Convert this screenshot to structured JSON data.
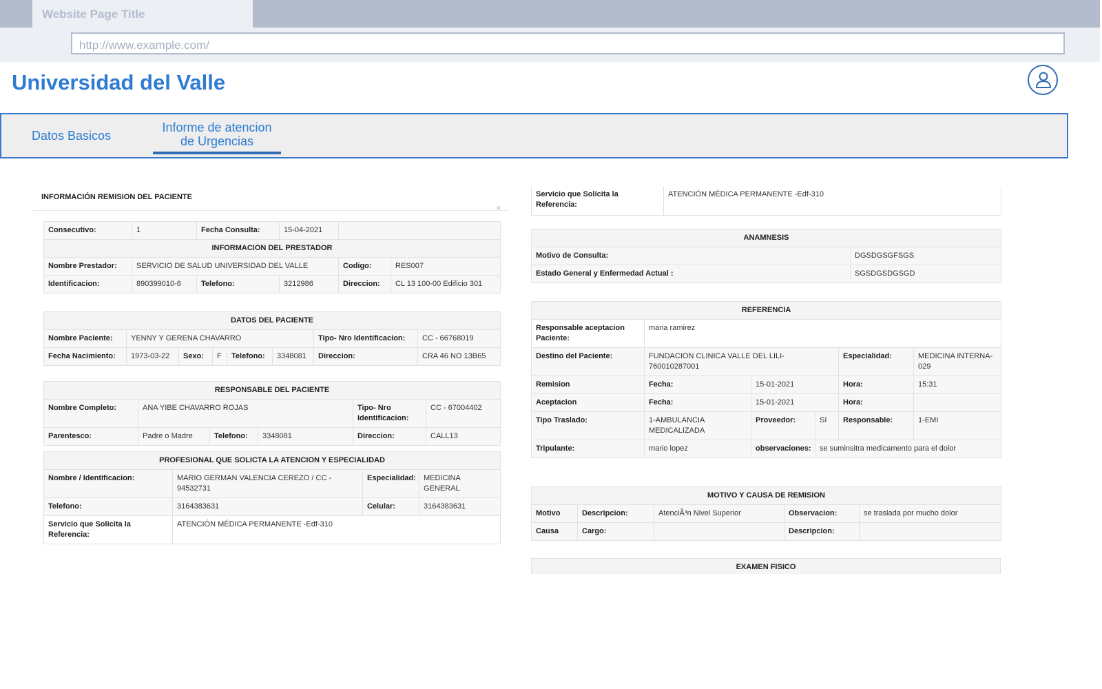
{
  "browser": {
    "tab_title": "Website Page Title",
    "url": "http://www.example.com/"
  },
  "app": {
    "title": "Universidad del Valle",
    "user_icon": "user-icon"
  },
  "tabs": [
    {
      "label": "Datos Basicos"
    },
    {
      "label_line1": "Informe de atencion",
      "label_line2": "de Urgencias"
    }
  ],
  "report": {
    "section_title": "INFORMACIÓN REMISION DEL PACIENTE",
    "close_symbol": "×",
    "consulta": {
      "consecutivo_label": "Consecutivo:",
      "consecutivo": "1",
      "fecha_label": "Fecha Consulta:",
      "fecha": "15-04-2021"
    },
    "prestador": {
      "title": "INFORMACION DEL PRESTADOR",
      "nombre_label": "Nombre Prestador:",
      "nombre": "SERVICIO DE SALUD UNIVERSIDAD DEL VALLE",
      "codigo_label": "Codigo:",
      "codigo": "RES007",
      "id_label": "Identificacion:",
      "id": "890399010-6",
      "tel_label": "Telefono:",
      "tel": "3212986",
      "dir_label": "Direccion:",
      "dir": "CL 13 100-00 Edificio 301"
    },
    "paciente": {
      "title": "DATOS DEL PACIENTE",
      "nombre_label": "Nombre Paciente:",
      "nombre": "YENNY Y GERENA CHAVARRO",
      "tipo_label": "Tipo- Nro Identificacion:",
      "tipo": "CC - 66768019",
      "nac_label": "Fecha Nacimiento:",
      "nac": "1973-03-22",
      "sexo_label": "Sexo:",
      "sexo": "F",
      "tel_label": "Telefono:",
      "tel": "3348081",
      "dir_label": "Direccion:",
      "dir": "CRA 46 NO 13B65"
    },
    "responsable": {
      "title": "RESPONSABLE DEL PACIENTE",
      "nombre_label": "Nombre Completo:",
      "nombre": "ANA YIBE CHAVARRO ROJAS",
      "tipo_label": "Tipo- Nro Identificacion:",
      "tipo": "CC - 67004402",
      "par_label": "Parentesco:",
      "par": "Padre o Madre",
      "tel_label": "Telefono:",
      "tel": "3348081",
      "dir_label": "Direccion:",
      "dir": "CALL13"
    },
    "profesional": {
      "title": "PROFESIONAL QUE SOLICTA LA ATENCION Y ESPECIALIDAD",
      "nombre_label": "Nombre / Identificacion:",
      "nombre": "MARIO GERMAN VALENCIA CEREZO / CC - 94532731",
      "esp_label": "Especialidad:",
      "esp": "MEDICINA GENERAL",
      "tel_label": "Telefono:",
      "tel": "3164383631",
      "cel_label": "Celular:",
      "cel": "3164383631",
      "serv_label": "Servicio que Solicita la Referencia:",
      "serv": "ATENCIÓN MÉDICA PERMANENTE -Edf-310"
    },
    "servicio_top": {
      "label": "Servicio que Solicita la Referencia:",
      "value": "ATENCIÓN MÉDICA PERMANENTE -Edf-310"
    },
    "anamnesis": {
      "title": "ANAMNESIS",
      "motivo_label": "Motivo de Consulta:",
      "motivo": "DGSDGSGFSGS",
      "estado_label": "Estado General y Enfermedad Actual :",
      "estado": "SGSDGSDGSGD"
    },
    "referencia": {
      "title": "REFERENCIA",
      "resp_label": "Responsable aceptacion Paciente:",
      "resp": "maria ramirez",
      "destino_label": "Destino del Paciente:",
      "destino": "FUNDACION CLINICA VALLE DEL LILI-760010287001",
      "esp_label": "Especialidad:",
      "esp": "MEDICINA INTERNA-029",
      "remision_label": "Remision",
      "fecha_label": "Fecha:",
      "remision_fecha": "15-01-2021",
      "hora_label": "Hora:",
      "remision_hora": "15:31",
      "aceptacion_label": "Aceptacion",
      "aceptacion_fecha": "15-01-2021",
      "aceptacion_hora": "",
      "traslado_label": "Tipo Traslado:",
      "traslado": "1-AMBULANCIA MEDICALIZADA",
      "proveedor_label": "Proveedor:",
      "proveedor": "SI",
      "responsable_label": "Responsable:",
      "responsable": "1-EMI",
      "tripulante_label": "Tripulante:",
      "tripulante": "mario lopez",
      "obs_label": "observaciones:",
      "obs": "se suminsitra medicamento para el dolor"
    },
    "motivo_causa": {
      "title": "MOTIVO Y CAUSA DE REMISION",
      "motivo_label": "Motivo",
      "desc_label": "Descripcion:",
      "motivo_desc": "AtenciÃ³n Nivel Superior",
      "obs_label": "Observacion:",
      "motivo_obs": "se traslada por mucho dolor",
      "causa_label": "Causa",
      "cargo_label": "Cargo:",
      "cargo": "",
      "desc2_label": "Descripcion:",
      "causa_desc": ""
    },
    "examen": {
      "title": "EXAMEN FISICO"
    }
  }
}
